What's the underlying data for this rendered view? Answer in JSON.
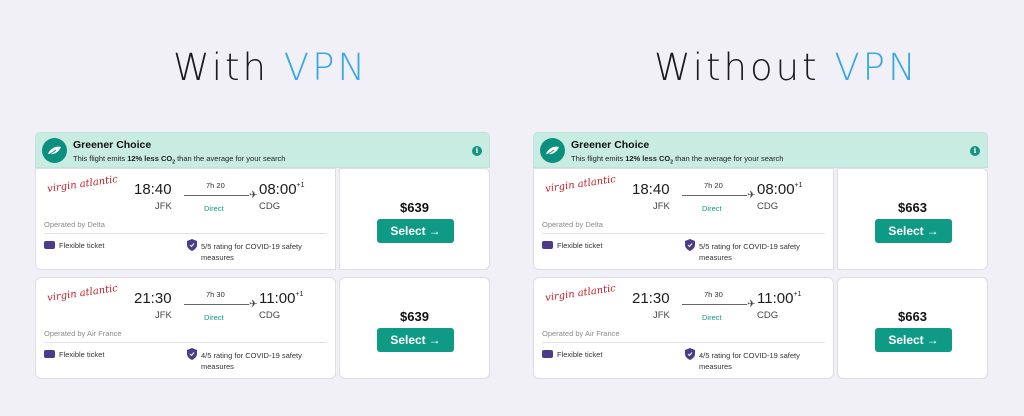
{
  "panels": [
    {
      "title_prefix": "With ",
      "title_accent": "VPN",
      "banner": {
        "title": "Greener Choice",
        "sub_before": "This flight emits ",
        "sub_bold": "12% less CO",
        "sub_sub": "2",
        "sub_after": " than the average for your search"
      },
      "flights": [
        {
          "airline": "virgin atlantic",
          "dep_time": "18:40",
          "dep_airport": "JFK",
          "duration": "7h 20",
          "stops": "Direct",
          "arr_time": "08:00",
          "arr_plus": "+1",
          "arr_airport": "CDG",
          "operated_by": "Operated by Delta",
          "ticket": "Flexible ticket",
          "covid": "5/5 rating for COVID-19 safety measures",
          "price": "$639",
          "select": "Select"
        },
        {
          "airline": "virgin atlantic",
          "dep_time": "21:30",
          "dep_airport": "JFK",
          "duration": "7h 30",
          "stops": "Direct",
          "arr_time": "11:00",
          "arr_plus": "+1",
          "arr_airport": "CDG",
          "operated_by": "Operated by Air France",
          "ticket": "Flexible ticket",
          "covid": "4/5 rating for COVID-19 safety measures",
          "price": "$639",
          "select": "Select"
        }
      ]
    },
    {
      "title_prefix": "Without ",
      "title_accent": "VPN",
      "banner": {
        "title": "Greener Choice",
        "sub_before": "This flight emits ",
        "sub_bold": "12% less CO",
        "sub_sub": "2",
        "sub_after": " than the average for your search"
      },
      "flights": [
        {
          "airline": "virgin atlantic",
          "dep_time": "18:40",
          "dep_airport": "JFK",
          "duration": "7h 20",
          "stops": "Direct",
          "arr_time": "08:00",
          "arr_plus": "+1",
          "arr_airport": "CDG",
          "operated_by": "Operated by Delta",
          "ticket": "Flexible ticket",
          "covid": "5/5 rating for COVID-19 safety measures",
          "price": "$663",
          "select": "Select"
        },
        {
          "airline": "virgin atlantic",
          "dep_time": "21:30",
          "dep_airport": "JFK",
          "duration": "7h 30",
          "stops": "Direct",
          "arr_time": "11:00",
          "arr_plus": "+1",
          "arr_airport": "CDG",
          "operated_by": "Operated by Air France",
          "ticket": "Flexible ticket",
          "covid": "4/5 rating for COVID-19 safety measures",
          "price": "$663",
          "select": "Select"
        }
      ]
    }
  ],
  "icons": {
    "banner": "leaf-icon",
    "info": "info-icon",
    "plane": "plane-icon",
    "ticket": "ticket-icon",
    "shield": "shield-icon",
    "arrow": "arrow-right-icon"
  },
  "colors": {
    "accent_blue": "#3aa8e0",
    "brand_teal": "#0f9a86",
    "banner_bg": "#c8ebe2",
    "page_bg": "#f1f0f6",
    "airline_red": "#c0202a"
  }
}
